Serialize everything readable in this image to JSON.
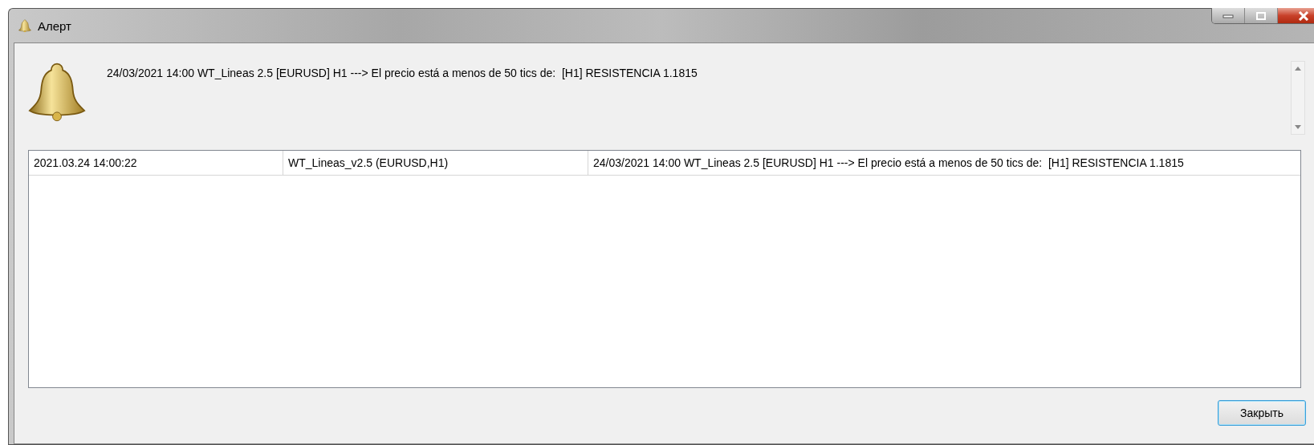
{
  "window": {
    "title": "Алерт"
  },
  "message": "24/03/2021 14:00 WT_Lineas 2.5 [EURUSD] H1 ---> El precio está a menos de 50 tics de:  [H1] RESISTENCIA 1.1815",
  "table": {
    "rows": [
      {
        "cells": [
          "2021.03.24 14:00:22",
          "WT_Lineas_v2.5 (EURUSD,H1)",
          "24/03/2021 14:00 WT_Lineas 2.5 [EURUSD] H1 ---> El precio está a menos de 50 tics de:  [H1] RESISTENCIA 1.1815"
        ]
      }
    ]
  },
  "buttons": [
    {
      "label": "Закрыть"
    }
  ]
}
